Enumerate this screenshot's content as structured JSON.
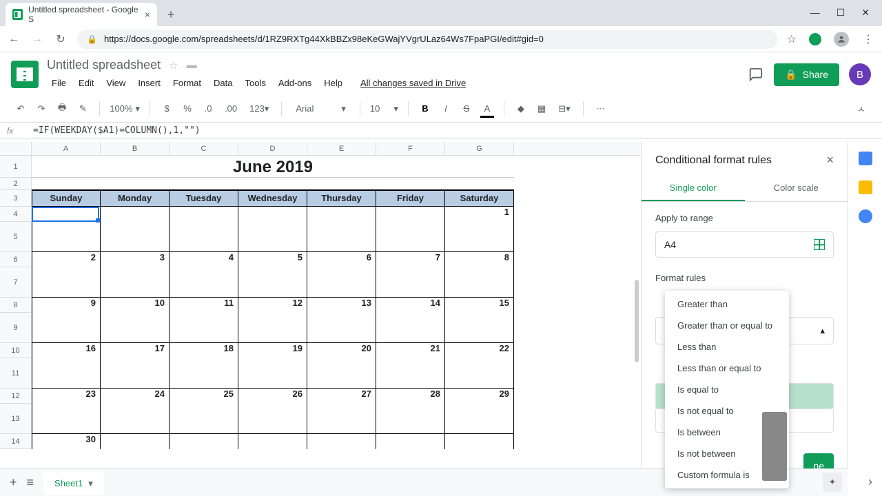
{
  "window": {
    "tab_title": "Untitled spreadsheet - Google S"
  },
  "address": {
    "url": "https://docs.google.com/spreadsheets/d/1RZ9RXTg44XkBBZx98eKeGWajYVgrULaz64Ws7FpaPGI/edit#gid=0"
  },
  "doc": {
    "title": "Untitled spreadsheet",
    "save_status": "All changes saved in Drive",
    "share": "Share",
    "avatar": "B"
  },
  "menus": [
    "File",
    "Edit",
    "View",
    "Insert",
    "Format",
    "Data",
    "Tools",
    "Add-ons",
    "Help"
  ],
  "toolbar": {
    "zoom": "100%",
    "font": "Arial",
    "size": "10"
  },
  "formula": "=IF(WEEKDAY($A1)=COLUMN(),1,\"\")",
  "columns": [
    "A",
    "B",
    "C",
    "D",
    "E",
    "F",
    "G"
  ],
  "rows": [
    "1",
    "2",
    "3",
    "4",
    "5",
    "6",
    "7",
    "8",
    "9",
    "10",
    "11",
    "12",
    "13",
    "14"
  ],
  "sheet": {
    "title": "June 2019",
    "days": [
      "Sunday",
      "Monday",
      "Tuesday",
      "Wednesday",
      "Thursday",
      "Friday",
      "Saturday"
    ],
    "weeks": [
      [
        "",
        "",
        "",
        "",
        "",
        "",
        "1"
      ],
      [
        "2",
        "3",
        "4",
        "5",
        "6",
        "7",
        "8"
      ],
      [
        "9",
        "10",
        "11",
        "12",
        "13",
        "14",
        "15"
      ],
      [
        "16",
        "17",
        "18",
        "19",
        "20",
        "21",
        "22"
      ],
      [
        "23",
        "24",
        "25",
        "26",
        "27",
        "28",
        "29"
      ],
      [
        "30",
        "",
        "",
        "",
        "",
        "",
        ""
      ]
    ]
  },
  "panel": {
    "title": "Conditional format rules",
    "tab_single": "Single color",
    "tab_scale": "Color scale",
    "apply_label": "Apply to range",
    "range": "A4",
    "rules_label": "Format rules",
    "done": "ne",
    "options": [
      "Greater than",
      "Greater than or equal to",
      "Less than",
      "Less than or equal to",
      "Is equal to",
      "Is not equal to",
      "Is between",
      "Is not between",
      "Custom formula is"
    ]
  },
  "tabs": {
    "sheet1": "Sheet1"
  }
}
